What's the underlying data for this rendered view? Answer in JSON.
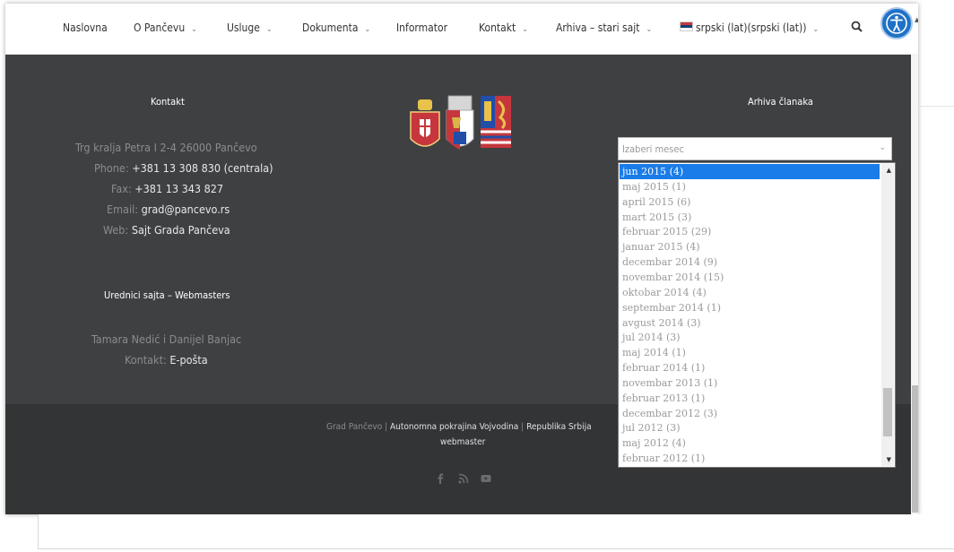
{
  "nav": {
    "items": [
      {
        "label": "Naslovna",
        "caret": false
      },
      {
        "label": "O Pančevu",
        "caret": true
      },
      {
        "label": "Usluge",
        "caret": true
      },
      {
        "label": "Dokumenta",
        "caret": true
      },
      {
        "label": "Informator",
        "caret": false
      },
      {
        "label": "Kontakt",
        "caret": true
      },
      {
        "label": "Arhiva – stari sajt",
        "caret": true
      }
    ],
    "caret_glyph": "⌄",
    "language": "srpski (lat)(srpski (lat))"
  },
  "contact": {
    "heading": "Kontakt",
    "address": "Trg kralja Petra I 2-4 26000 Pančevo",
    "phone_label": "Phone:",
    "phone": "+381 13 308 830 (centrala)",
    "fax_label": "Fax:",
    "fax": "+381 13 343 827",
    "email_label": "Email:",
    "email": "grad@pancevo.rs",
    "web_label": "Web:",
    "web": "Sajt Grada Pančeva"
  },
  "editors": {
    "heading": "Urednici sajta – Webmasters",
    "names": "Tamara Nedić i Danijel Banjac",
    "contact_label": "Kontakt:",
    "contact_link": "E-pošta"
  },
  "archive": {
    "heading": "Arhiva članaka",
    "placeholder": "Izaberi mesec",
    "options": [
      "jun 2015  (4)",
      "maj 2015  (1)",
      "april 2015  (6)",
      "mart 2015  (3)",
      "februar 2015  (29)",
      "januar 2015  (4)",
      "decembar 2014  (9)",
      "novembar 2014  (15)",
      "oktobar 2014  (4)",
      "septembar 2014  (1)",
      "avgust 2014  (3)",
      "jul 2014  (3)",
      "maj 2014  (1)",
      "februar 2014  (1)",
      "novembar 2013  (1)",
      "februar 2013  (1)",
      "decembar 2012  (3)",
      "jul 2012  (3)",
      "maj 2012  (4)",
      "februar 2012  (1)"
    ],
    "selected_index": 0
  },
  "bottom": {
    "link_city": "Grad Pančevo",
    "separator": "|",
    "link_province": "Autonomna pokrajina Vojvodina",
    "link_republic": "Republika Srbija",
    "webmaster": "webmaster"
  },
  "social_icons": [
    "facebook-icon",
    "rss-icon",
    "youtube-icon"
  ],
  "colors": {
    "footer_bg": "#3f4042",
    "bottom_bg": "#333436",
    "selected_option": "#1a7ce8",
    "accessibility_button": "#1f72c6"
  }
}
